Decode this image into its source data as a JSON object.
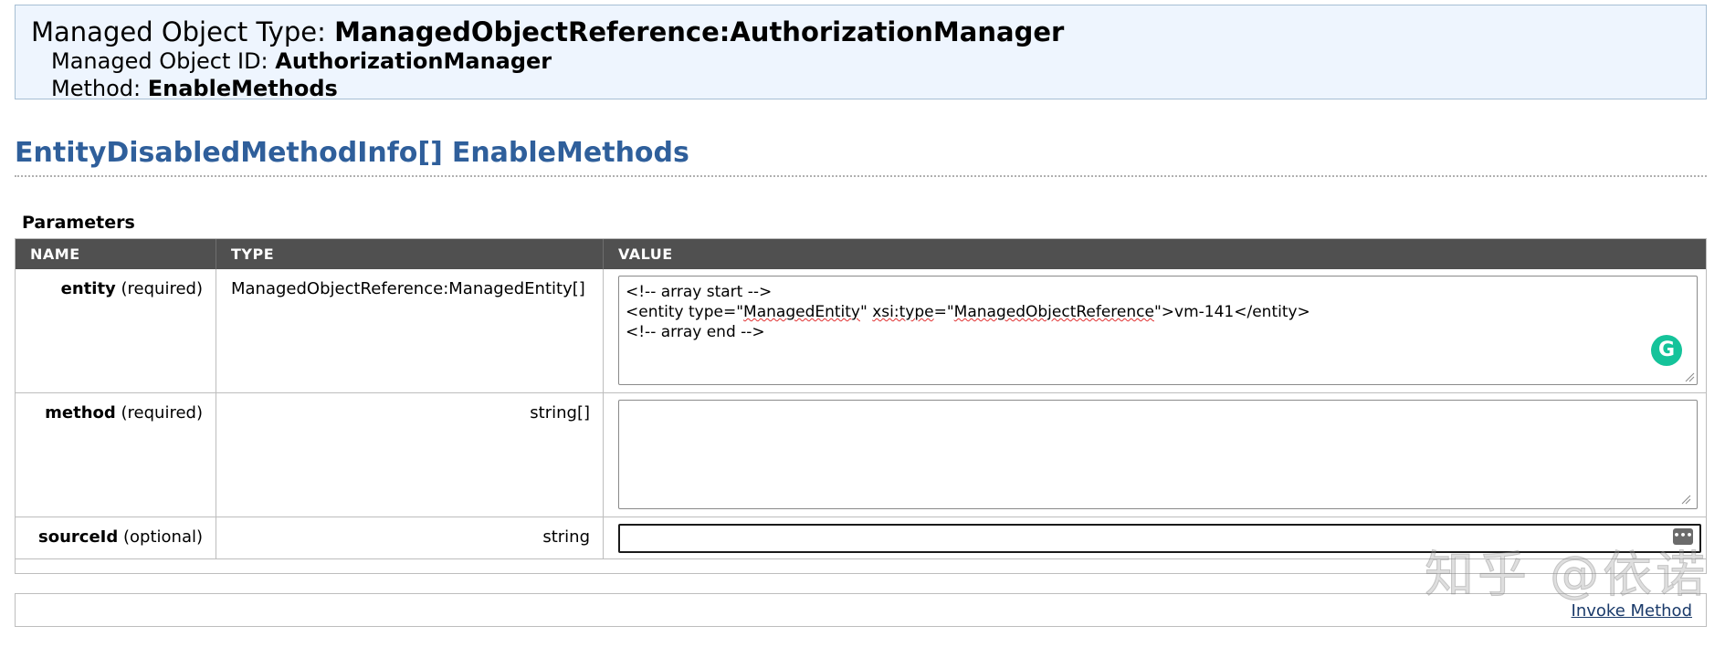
{
  "header": {
    "type_label": "Managed Object Type:",
    "type_value": "ManagedObjectReference:AuthorizationManager",
    "id_label": "Managed Object ID:",
    "id_value": "AuthorizationManager",
    "method_label": "Method:",
    "method_value": "EnableMethods"
  },
  "method_signature": {
    "return_type": "EntityDisabledMethodInfo[]",
    "name": "EnableMethods"
  },
  "parameters": {
    "heading": "Parameters",
    "columns": [
      "NAME",
      "TYPE",
      "VALUE"
    ],
    "rows": [
      {
        "name": "entity",
        "qualifier": "(required)",
        "type": "ManagedObjectReference:ManagedEntity[]",
        "value_lines": [
          "<!-- array start -->",
          "<entity type=\"ManagedEntity\" xsi:type=\"ManagedObjectReference\">vm-141</entity>",
          "<!-- array end -->"
        ],
        "value_parts": {
          "l2_a": "<entity type=\"",
          "l2_b": "ManagedEntity",
          "l2_c": "\" ",
          "l2_d": "xsi:type",
          "l2_e": "=\"",
          "l2_f": "ManagedObjectReference",
          "l2_g": "\">vm-141</entity>"
        }
      },
      {
        "name": "method",
        "qualifier": "(required)",
        "type": "string[]",
        "value": ""
      },
      {
        "name": "sourceId",
        "qualifier": "(optional)",
        "type": "string",
        "value": ""
      }
    ]
  },
  "icons": {
    "grammarly": "grammarly-icon",
    "autofill": "autofill-icon",
    "resize": "resize-grip-icon"
  },
  "grammarly_letter": "G",
  "autofill_glyph": "•••",
  "invoke_label": "Invoke Method",
  "watermark_text": "知乎 @依诺",
  "colors": {
    "header_bg": "#eef5fe",
    "title_blue": "#2f5f9b",
    "table_header_bg": "#505050",
    "grammarly_green": "#15c39a"
  }
}
